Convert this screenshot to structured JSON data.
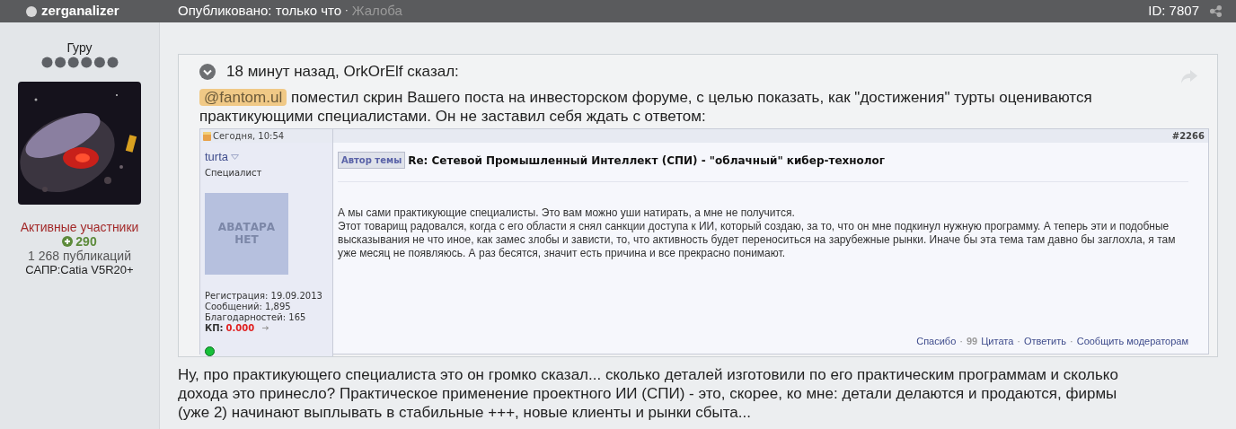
{
  "header": {
    "author": "zerganalizer",
    "posted": "Опубликовано: только что",
    "separator": "·",
    "report": "Жалоба",
    "id": "ID: 7807"
  },
  "profile": {
    "rank": "Гуру",
    "group": "Активные участники",
    "reputation": "290",
    "posts": "1 268 публикаций",
    "signature_field": "САПР:Catia V5R20+"
  },
  "quote": {
    "heading": "18 минут назад, OrkOrElf сказал:",
    "mention": "@fantom.ul",
    "text": "поместил скрин Вашего поста на инвесторском форуме, с целью показать, как \"достижения\" турты оцениваются практикующими специалистами. Он не заставил себя ждать с ответом:",
    "screenshot": {
      "date": "Сегодня, 10:54",
      "post_number": "#2266",
      "user": "turta",
      "user_title": "Специалист",
      "avatar_text": "АВАТАРА НЕТ",
      "stats": [
        "Регистрация: 19.09.2013",
        "Сообщений: 1,895",
        "Благодарностей: 165"
      ],
      "kp_label": "КП:",
      "kp_value": "0.000",
      "badge": "Автор темы",
      "title": "Re: Сетевой Промышленный Интеллект (СПИ) - \"облачный\" кибер-технолог",
      "body": [
        "А мы сами практикующие специалисты. Это вам можно уши натирать, а мне не получится.",
        "Этот товарищ радовался, когда с его области я снял санкции доступа к ИИ, который создаю, за то, что он мне подкинул нужную программу. А теперь эти и подобные высказывания не что иное, как замес злобы и зависти, то, что активность будет переноситься на зарубежные рынки. Иначе бы эта тема там давно бы заглохла, я там уже месяц не появляюсь. А раз бесятся, значит есть причина и все прекрасно понимают."
      ],
      "actions": [
        {
          "kind": "link",
          "label": "Спасибо"
        },
        {
          "kind": "quote",
          "separator": "·",
          "label": "Цитата",
          "icon": "99"
        },
        {
          "kind": "link",
          "separator": "·",
          "label": "Ответить"
        },
        {
          "kind": "link",
          "separator": "·",
          "label": "Сообщить модераторам"
        }
      ]
    }
  },
  "reply": "Ну, про практикующего специалиста это он громко сказал... сколько деталей изготовили по его практическим программам и сколько дохода это принесло? Практическое применение проектного ИИ (СПИ) - это, скорее, ко мне: детали делаются и продаются, фирмы (уже 2) начинают выплывать в стабильные +++, новые клиенты и рынки сбыта..."
}
